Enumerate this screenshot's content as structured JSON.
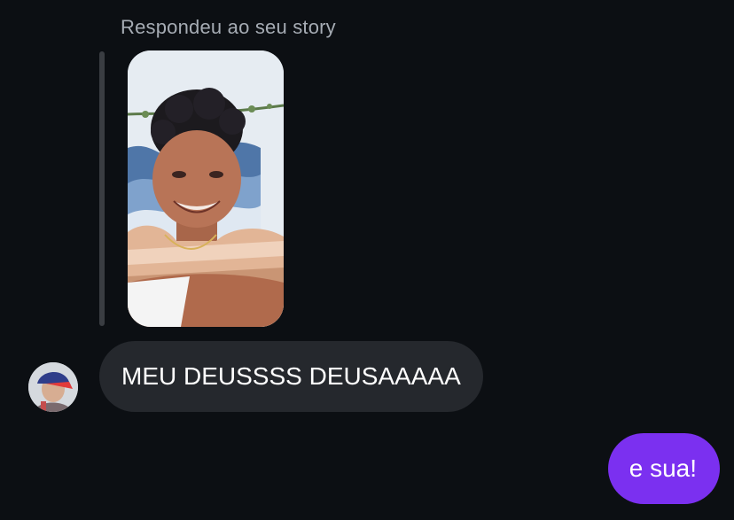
{
  "conversation": {
    "story_reply_label": "Respondeu ao seu story",
    "incoming_message": "MEU DEUSSSS DEUSAAAAA",
    "outgoing_message": "e sua!"
  },
  "colors": {
    "background": "#0c0f13",
    "incoming_bubble": "#25282d",
    "outgoing_bubble": "#7b30f0",
    "secondary_text": "#a6acb4"
  }
}
